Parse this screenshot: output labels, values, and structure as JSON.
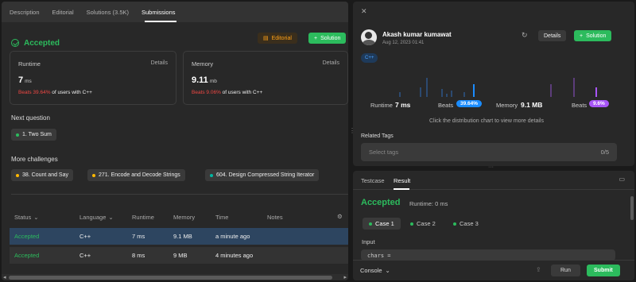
{
  "left": {
    "tabs": [
      "Description",
      "Editorial",
      "Solutions (3.5K)",
      "Submissions"
    ],
    "status": "Accepted",
    "editorial_label": "Editorial",
    "solution_label": "Solution",
    "runtime": {
      "label": "Runtime",
      "details": "Details",
      "value": "7",
      "unit": "ms",
      "beats_pct": "Beats 39.64%",
      "beats_text": "of users with C++"
    },
    "memory": {
      "label": "Memory",
      "details": "Details",
      "value": "9.11",
      "unit": "mb",
      "beats_pct": "Beats 9.06%",
      "beats_text": "of users with C++"
    },
    "next_question_title": "Next question",
    "next_question": "1. Two Sum",
    "more_challenges_title": "More challenges",
    "challenges": [
      "38. Count and Say",
      "271. Encode and Decode Strings",
      "604. Design Compressed String Iterator"
    ],
    "table": {
      "headers": [
        "Status",
        "Language",
        "Runtime",
        "Memory",
        "Time",
        "Notes"
      ],
      "rows": [
        {
          "status": "Accepted",
          "language": "C++",
          "runtime": "7 ms",
          "memory": "9.1 MB",
          "time": "a minute ago"
        },
        {
          "status": "Accepted",
          "language": "C++",
          "runtime": "8 ms",
          "memory": "9 MB",
          "time": "4 minutes ago"
        }
      ]
    }
  },
  "right_top": {
    "close": "✕",
    "user_name": "Akash kumar kumawat",
    "date": "Aug 12, 2023 01:41",
    "details_label": "Details",
    "solution_label": "Solution",
    "lang_tag": "C++",
    "runtime_label": "Runtime",
    "runtime_value": "7 ms",
    "beats_label": "Beats",
    "runtime_beats": "39.64%",
    "memory_label": "Memory",
    "memory_value": "9.1 MB",
    "memory_beats": "9.6%",
    "chart_hint": "Click the distribution chart to view more details",
    "related_tags": "Related Tags",
    "select_tags_placeholder": "Select tags",
    "tags_count": "0/5"
  },
  "right_bottom": {
    "tabs": [
      "Testcase",
      "Result"
    ],
    "status": "Accepted",
    "runtime": "Runtime: 0 ms",
    "cases": [
      "Case 1",
      "Case 2",
      "Case 3"
    ],
    "input_label": "Input",
    "input_value": "chars =",
    "console_label": "Console",
    "run_label": "Run",
    "submit_label": "Submit"
  },
  "colors": {
    "accent_green": "#2cbb5d",
    "orange": "#ffa116",
    "blue_pill": "#1a8cff",
    "purple_pill": "#a855f7",
    "red": "#ef4743"
  }
}
